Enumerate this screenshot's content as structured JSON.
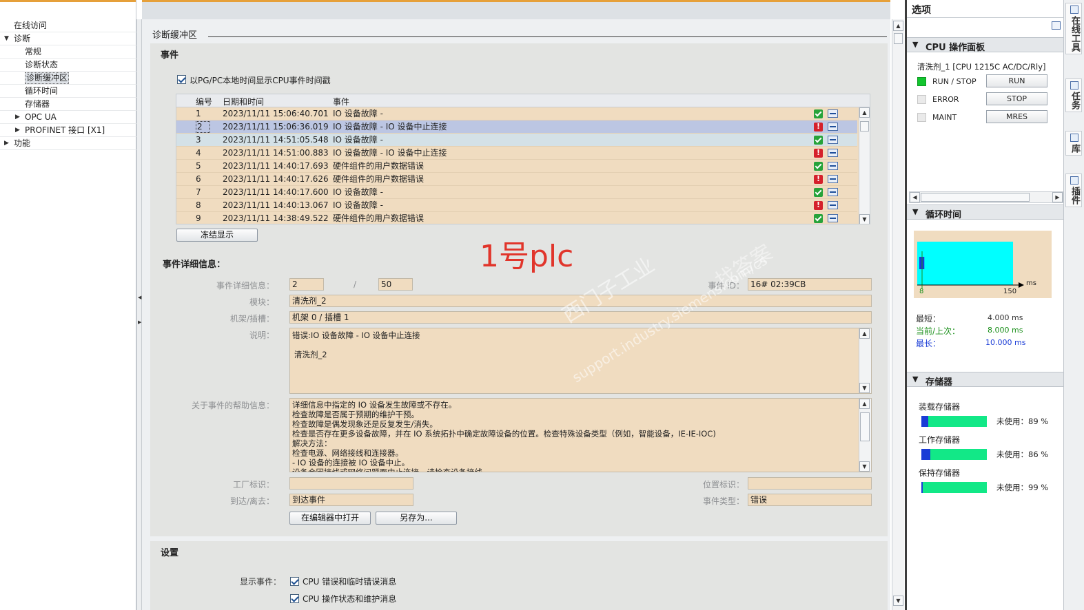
{
  "left_tree": {
    "items": [
      {
        "label": "在线访问",
        "indent": 0,
        "arrow": ""
      },
      {
        "label": "诊断",
        "indent": 0,
        "arrow": "▼"
      },
      {
        "label": "常规",
        "indent": 2,
        "arrow": ""
      },
      {
        "label": "诊断状态",
        "indent": 2,
        "arrow": ""
      },
      {
        "label": "诊断缓冲区",
        "indent": 2,
        "arrow": "",
        "selected": true
      },
      {
        "label": "循环时间",
        "indent": 2,
        "arrow": ""
      },
      {
        "label": "存储器",
        "indent": 2,
        "arrow": ""
      },
      {
        "label": "OPC UA",
        "indent": 1,
        "arrow": "▶"
      },
      {
        "label": "PROFINET 接口 [X1]",
        "indent": 1,
        "arrow": "▶"
      },
      {
        "label": "功能",
        "indent": 0,
        "arrow": "▶"
      }
    ]
  },
  "main": {
    "page_title": "诊断缓冲区",
    "events_section": {
      "title": "事件",
      "checkbox_label": "以PG/PC本地时间显示CPU事件时间戳",
      "columns": [
        "编号",
        "日期和时间",
        "事件"
      ],
      "rows": [
        {
          "no": "1",
          "datetime": "2023/11/11 15:06:40.701",
          "event": "IO 设备故障 -",
          "status": "ok"
        },
        {
          "no": "2",
          "datetime": "2023/11/11 15:06:36.019",
          "event": "IO 设备故障 - IO 设备中止连接",
          "status": "error"
        },
        {
          "no": "3",
          "datetime": "2023/11/11 14:51:05.548",
          "event": "IO 设备故障 -",
          "status": "ok"
        },
        {
          "no": "4",
          "datetime": "2023/11/11 14:51:00.883",
          "event": "IO 设备故障 - IO 设备中止连接",
          "status": "error"
        },
        {
          "no": "5",
          "datetime": "2023/11/11 14:40:17.693",
          "event": "硬件组件的用户数据错误",
          "status": "ok"
        },
        {
          "no": "6",
          "datetime": "2023/11/11 14:40:17.626",
          "event": "硬件组件的用户数据错误",
          "status": "error"
        },
        {
          "no": "7",
          "datetime": "2023/11/11 14:40:17.600",
          "event": "IO 设备故障 -",
          "status": "ok"
        },
        {
          "no": "8",
          "datetime": "2023/11/11 14:40:13.067",
          "event": "IO 设备故障 -",
          "status": "error"
        },
        {
          "no": "9",
          "datetime": "2023/11/11 14:38:49.522",
          "event": "硬件组件的用户数据错误",
          "status": "ok"
        }
      ],
      "freeze_button": "冻结显示"
    },
    "watermark": {
      "plc_label": "1号plc",
      "site_cn": "西门子工业",
      "site_url": "support.industry.siemens.com/cs",
      "site_cn2": "找答案"
    },
    "details": {
      "title": "事件详细信息：",
      "detail_info_label": "事件详细信息：",
      "detail_info_value": "2",
      "detail_sep": "/",
      "detail_total": "50",
      "event_id_label": "事件 ID：",
      "event_id_value": "16# 02:39CB",
      "module_label": "模块：",
      "module_value": "清洗剂_2",
      "rack_label": "机架/插槽：",
      "rack_value": "机架 0 / 插槽 1",
      "desc_label": "说明：",
      "desc_lines": [
        "错误:IO 设备故障 - IO 设备中止连接",
        "清洗剂_2"
      ],
      "help_label": "关于事件的帮助信息：",
      "help_lines": [
        "详细信息中指定的 IO 设备发生故障或不存在。",
        "检查故障是否属于预期的维护干预。",
        "检查故障是偶发现象还是反复发生/消失。",
        "检查是否存在更多设备故障，并在 IO 系统拓扑中确定故障设备的位置。检查特殊设备类型（例如，智能设备，IE-IE-IOC)",
        "解决方法：",
        "检查电源、网络接线和连接器。",
        "- IO 设备的连接被 IO 设备中止。",
        "设备会因接线或网络问题而中止连接。请检查设备接线。"
      ],
      "plant_label": "工厂标识：",
      "plant_value": "",
      "location_label": "位置标识：",
      "location_value": "",
      "inout_label": "到达/离去：",
      "inout_value": "到达事件",
      "type_label": "事件类型：",
      "type_value": "错误",
      "open_editor_button": "在编辑器中打开",
      "save_as_button": "另存为..."
    },
    "settings": {
      "title": "设置",
      "show_events_label": "显示事件：",
      "options": [
        "CPU 错误和临时错误消息",
        "CPU 操作状态和维护消息"
      ]
    }
  },
  "right_pane": {
    "title": "选项",
    "cpu_panel": {
      "title": "CPU 操作面板",
      "device": "清洗剂_1 [CPU 1215C AC/DC/Rly]",
      "leds": [
        {
          "label": "RUN / STOP",
          "on": true,
          "button": "RUN"
        },
        {
          "label": "ERROR",
          "on": false,
          "button": "STOP"
        },
        {
          "label": "MAINT",
          "on": false,
          "button": "MRES"
        }
      ]
    },
    "cycle_time": {
      "title": "循环时间",
      "axis_unit": "ms",
      "axis_min": "8",
      "axis_max": "150",
      "shortest_label": "最短：",
      "shortest_value": "4.000 ms",
      "current_label": "当前/上次：",
      "current_value": "8.000 ms",
      "longest_label": "最长：",
      "longest_value": "10.000 ms",
      "colors": {
        "area": "#00ffff",
        "bar": "#1a3cd6",
        "current": "#1a8f1a",
        "longest": "#1a3cd6"
      }
    },
    "memory": {
      "title": "存储器",
      "items": [
        {
          "label": "装载存储器",
          "unused_label": "未使用：89 %",
          "used_fraction": 0.11
        },
        {
          "label": "工作存储器",
          "unused_label": "未使用：86 %",
          "used_fraction": 0.14
        },
        {
          "label": "保持存储器",
          "unused_label": "未使用：99 %",
          "used_fraction": 0.01
        }
      ]
    }
  },
  "vertical_tabs": [
    "在线工具",
    "任务",
    "库",
    "插件"
  ]
}
